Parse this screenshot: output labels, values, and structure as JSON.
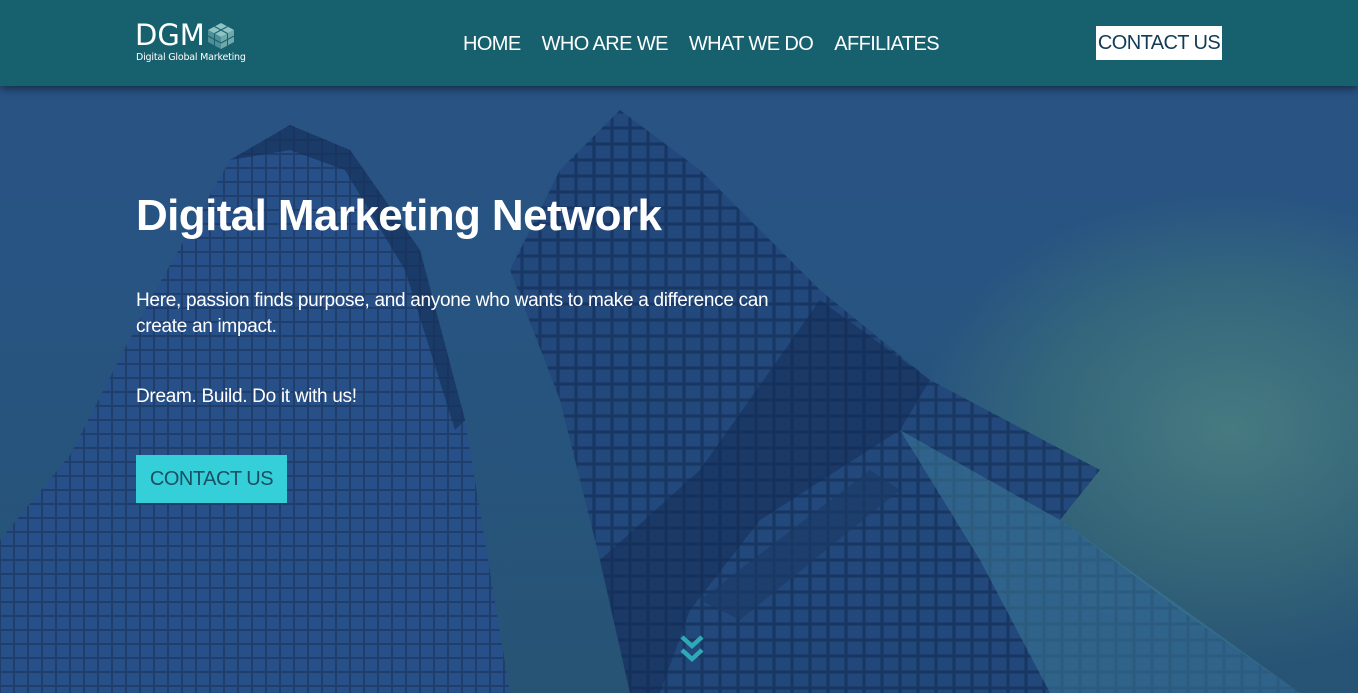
{
  "header": {
    "logo_text": "DGM",
    "logo_subtitle": "Digital Global Marketing",
    "nav": [
      {
        "label": "HOME"
      },
      {
        "label": "WHO ARE WE"
      },
      {
        "label": "WHAT WE DO"
      },
      {
        "label": "AFFILIATES"
      }
    ],
    "cta_label": "CONTACT US"
  },
  "hero": {
    "title": "Digital Marketing Network",
    "lead": "Here, passion finds purpose, and anyone who wants to make a difference can create an impact.",
    "tagline": "Dream. Build. Do it with us!",
    "cta_label": "CONTACT US",
    "scroll_icon": "double-chevron-down-icon"
  },
  "colors": {
    "header_bg": "#17616e",
    "accent": "#34cfd9",
    "hero_overlay": "#2b5487",
    "text": "#ffffff"
  }
}
